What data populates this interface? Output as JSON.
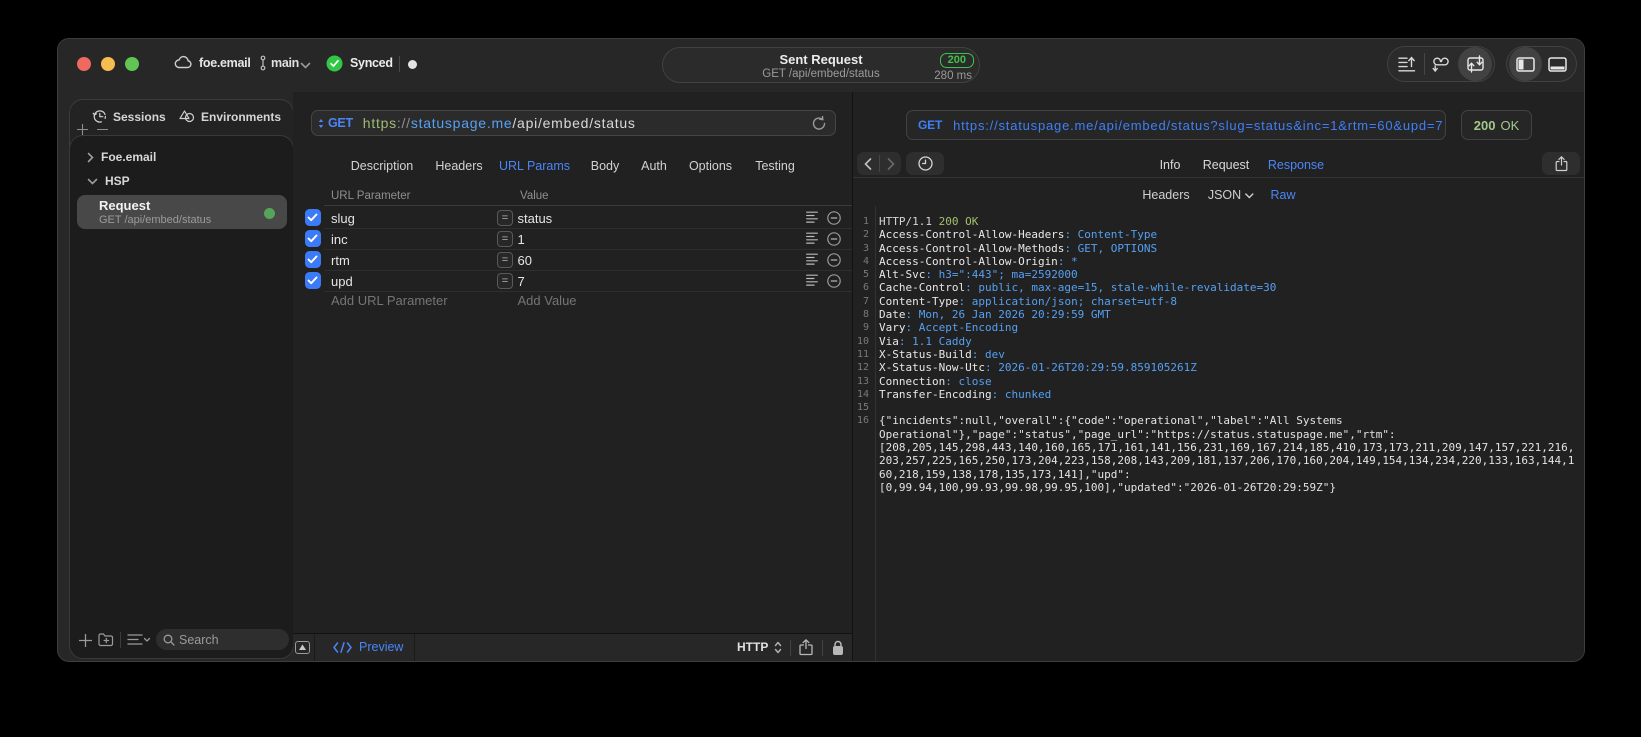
{
  "titlebar": {
    "project": "foe.email",
    "branch": "main",
    "sync_status": "Synced",
    "sent_request": {
      "title": "Sent Request",
      "subtitle": "GET /api/embed/status",
      "status_code": "200",
      "duration": "280 ms"
    }
  },
  "sidebar": {
    "tabs": [
      {
        "label": "Sessions"
      },
      {
        "label": "Environments"
      }
    ],
    "tree": [
      {
        "label": "Foe.email"
      },
      {
        "label": "HSP"
      }
    ],
    "selected_request": {
      "title": "Request",
      "subtitle": "GET /api/embed/status"
    },
    "search_placeholder": "Search"
  },
  "request_editor": {
    "method": "GET",
    "url": {
      "scheme": "https",
      "separator": "://",
      "host": "statuspage.me",
      "path": "/api/embed/status"
    },
    "tabs": [
      "Description",
      "Headers",
      "URL Params",
      "Body",
      "Auth",
      "Options",
      "Testing"
    ],
    "active_tab": "URL Params",
    "params_table": {
      "columns": [
        "URL Parameter",
        "Value"
      ],
      "rows": [
        {
          "checked": true,
          "name": "slug",
          "operator": "=",
          "value": "status"
        },
        {
          "checked": true,
          "name": "inc",
          "operator": "=",
          "value": "1"
        },
        {
          "checked": true,
          "name": "rtm",
          "operator": "=",
          "value": "60"
        },
        {
          "checked": true,
          "name": "upd",
          "operator": "=",
          "value": "7"
        }
      ],
      "add_name_placeholder": "Add URL Parameter",
      "add_value_placeholder": "Add Value"
    },
    "footer": {
      "code_glyph": "</>",
      "preview_label": "Preview",
      "protocol": "HTTP"
    }
  },
  "response_viewer": {
    "request_line": {
      "method": "GET",
      "url": "https://statuspage.me/api/embed/status?slug=status&inc=1&rtm=60&upd=7"
    },
    "status": {
      "code": "200",
      "text": "OK"
    },
    "tabs": [
      "Info",
      "Request",
      "Response"
    ],
    "active_tab": "Response",
    "subtabs": [
      "Headers",
      "JSON",
      "Raw"
    ],
    "active_subtab": "Raw",
    "raw_response": {
      "status_line": {
        "protocol": "HTTP/1.1",
        "status": "200 OK"
      },
      "headers": [
        {
          "name": "Access-Control-Allow-Headers",
          "value": "Content-Type"
        },
        {
          "name": "Access-Control-Allow-Methods",
          "value": "GET, OPTIONS"
        },
        {
          "name": "Access-Control-Allow-Origin",
          "value": "*"
        },
        {
          "name": "Alt-Svc",
          "value": "h3=\":443\"; ma=2592000"
        },
        {
          "name": "Cache-Control",
          "value": "public, max-age=15, stale-while-revalidate=30"
        },
        {
          "name": "Content-Type",
          "value": "application/json; charset=utf-8"
        },
        {
          "name": "Date",
          "value": "Mon, 26 Jan 2026 20:29:59 GMT"
        },
        {
          "name": "Vary",
          "value": "Accept-Encoding"
        },
        {
          "name": "Via",
          "value": "1.1 Caddy"
        },
        {
          "name": "X-Status-Build",
          "value": "dev"
        },
        {
          "name": "X-Status-Now-Utc",
          "value": "2026-01-26T20:29:59.859105261Z"
        },
        {
          "name": "Connection",
          "value": "close"
        },
        {
          "name": "Transfer-Encoding",
          "value": "chunked"
        }
      ],
      "body_lines": [
        "{\"incidents\":null,\"overall\":{\"code\":\"operational\",\"label\":\"All Systems",
        "Operational\"},\"page\":\"status\",\"page_url\":\"https://status.statuspage.me\",\"rtm\":",
        "[208,205,145,298,443,140,160,165,171,161,141,156,231,169,167,214,185,410,173,173,211,209,147,157,221,216,",
        "203,257,225,165,250,173,204,223,158,208,143,209,181,137,206,170,160,204,149,154,134,234,220,133,163,144,1",
        "60,218,159,138,178,135,173,141],\"upd\":",
        "[0,99.94,100,99.93,99.98,99.95,100],\"updated\":\"2026-01-26T20:29:59Z\"}"
      ]
    }
  },
  "colors": {
    "accent_blue": "#4a86f7",
    "value_blue": "#55a0f2",
    "badge_green": "#40c14b",
    "status_green": "#a3c98a",
    "olive_green": "#a2c06d",
    "traffic_red": "#ee6a5f",
    "traffic_yellow": "#f5bd4f",
    "traffic_green": "#61c554"
  }
}
